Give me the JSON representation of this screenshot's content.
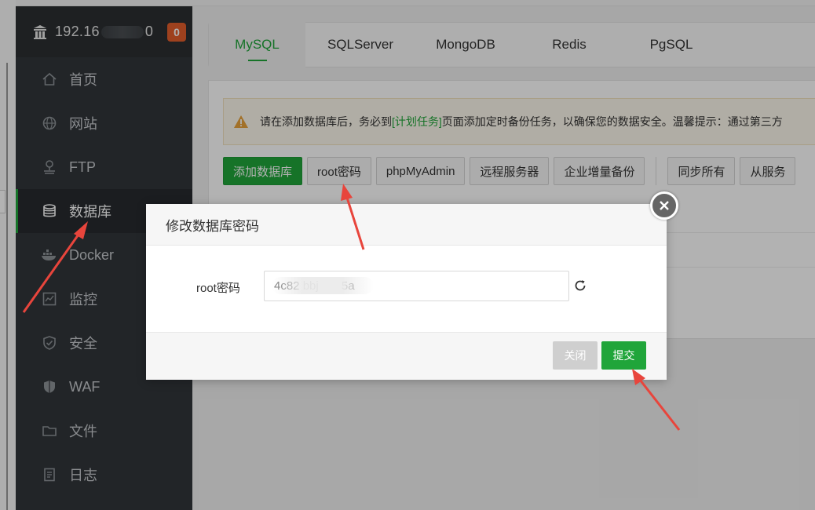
{
  "sidebar": {
    "server_ip_prefix": "192.16",
    "server_ip_suffix": "0",
    "alert_count": "0",
    "items": [
      {
        "label": "首页",
        "icon": "home-icon"
      },
      {
        "label": "网站",
        "icon": "globe-icon"
      },
      {
        "label": "FTP",
        "icon": "ftp-icon"
      },
      {
        "label": "数据库",
        "icon": "database-icon",
        "active": true
      },
      {
        "label": "Docker",
        "icon": "docker-icon"
      },
      {
        "label": "监控",
        "icon": "monitor-icon"
      },
      {
        "label": "安全",
        "icon": "shield-icon"
      },
      {
        "label": "WAF",
        "icon": "waf-icon"
      },
      {
        "label": "文件",
        "icon": "folder-icon"
      },
      {
        "label": "日志",
        "icon": "log-icon"
      }
    ]
  },
  "tabs": [
    "MySQL",
    "SQLServer",
    "MongoDB",
    "Redis",
    "PgSQL"
  ],
  "notice": {
    "before": "请在添加数据库后，务必到",
    "link": "[计划任务]",
    "after": "页面添加定时备份任务，以确保您的数据安全。温馨提示：通过第三方"
  },
  "toolbar": {
    "add_db": "添加数据库",
    "root_password": "root密码",
    "phpmyadmin": "phpMyAdmin",
    "remote_server": "远程服务器",
    "incremental_backup": "企业增量备份",
    "sync_all": "同步所有",
    "from_server": "从服务"
  },
  "modal": {
    "title": "修改数据库密码",
    "field_label": "root密码",
    "field_value": "4c82 bbj       5a",
    "close_label": "关闭",
    "submit_label": "提交"
  },
  "colors": {
    "accent": "#20a53a",
    "sidebar_bg": "#32363a",
    "badge": "#e25d2b",
    "annotation_arrow": "#e8453c"
  }
}
